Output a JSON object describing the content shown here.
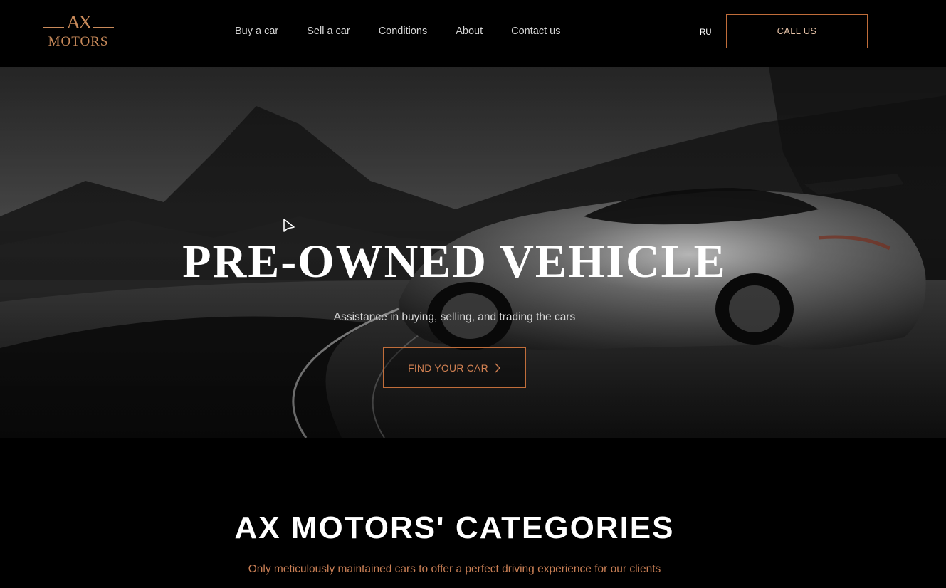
{
  "header": {
    "logo": {
      "mark": "AX",
      "word": "MOTORS"
    },
    "nav": [
      {
        "label": "Buy a car"
      },
      {
        "label": "Sell a car"
      },
      {
        "label": "Conditions"
      },
      {
        "label": "About"
      },
      {
        "label": "Contact us"
      }
    ],
    "language": "RU",
    "call_button": "CALL US"
  },
  "hero": {
    "title": "PRE-OWNED VEHICLE",
    "subtitle": "Assistance in buying, selling, and trading the cars",
    "cta": "FIND YOUR CAR",
    "cta_icon": "chevron-right-icon"
  },
  "categories": {
    "title": "AX MOTORS' CATEGORIES",
    "subtitle": "Only meticulously maintained cars to offer a perfect driving experience for our clients"
  },
  "colors": {
    "background": "#000000",
    "accent": "#c06d3a",
    "accent_text": "#d28152",
    "logo": "#c98a5a"
  }
}
